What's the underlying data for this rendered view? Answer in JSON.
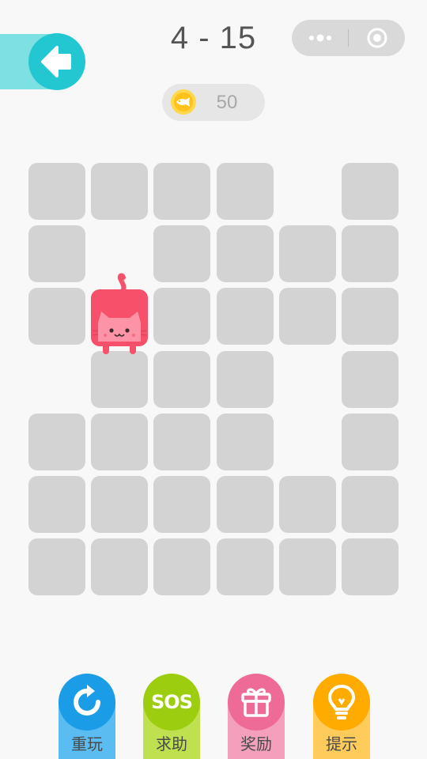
{
  "header": {
    "level": "4 - 15",
    "back_icon": "arrow-left-icon",
    "capsule": {
      "more_icon": "more-dots-icon",
      "close_icon": "target-close-icon"
    }
  },
  "coins": {
    "count": "50",
    "icon": "fish-coin-icon"
  },
  "board": {
    "rows": 7,
    "cols": 6,
    "cells": [
      [
        1,
        1,
        1,
        1,
        0,
        1
      ],
      [
        1,
        0,
        1,
        1,
        1,
        1
      ],
      [
        1,
        2,
        1,
        1,
        1,
        1
      ],
      [
        0,
        1,
        1,
        1,
        0,
        1
      ],
      [
        1,
        1,
        1,
        1,
        0,
        1
      ],
      [
        1,
        1,
        1,
        1,
        1,
        1
      ],
      [
        1,
        1,
        1,
        1,
        1,
        1
      ]
    ],
    "legend": {
      "0": "empty",
      "1": "tile",
      "2": "cat"
    },
    "tile_color": "#d3d3d3",
    "cat_color": "#f7506a"
  },
  "actions": [
    {
      "label": "重玩",
      "icon": "replay-icon",
      "color": "#1a9de6",
      "tail_color": "#5bbcf2"
    },
    {
      "label": "求助",
      "icon_text": "SOS",
      "icon": "sos-icon",
      "color": "#9ccd0e",
      "tail_color": "#bfe04f"
    },
    {
      "label": "奖励",
      "icon": "gift-icon",
      "color": "#ee6b98",
      "tail_color": "#f4a0bd"
    },
    {
      "label": "提示",
      "icon": "lightbulb-icon",
      "color": "#ffab00",
      "tail_color": "#ffcb5a"
    }
  ]
}
